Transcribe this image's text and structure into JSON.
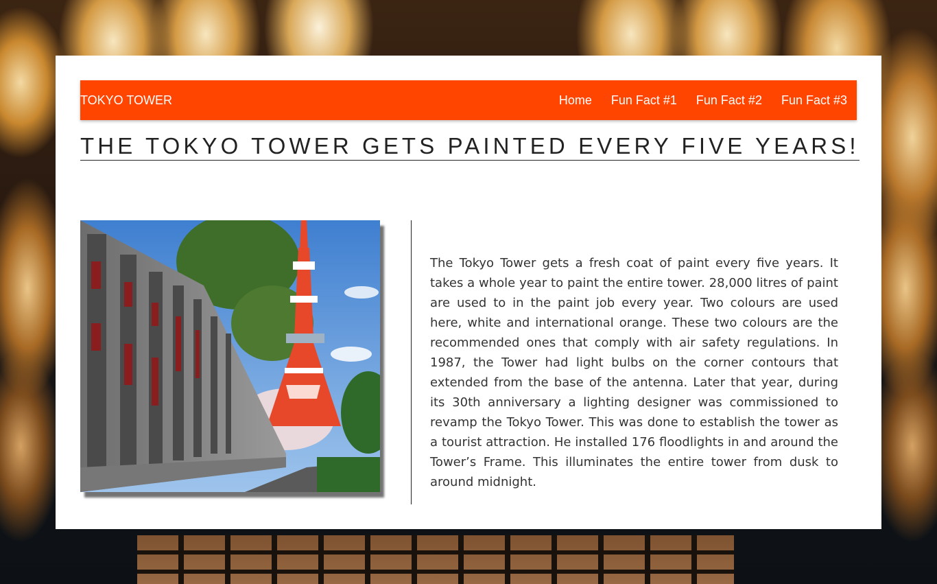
{
  "navbar": {
    "brand": "TOKYO TOWER",
    "links": [
      "Home",
      "Fun Fact #1",
      "Fun Fact #2",
      "Fun Fact #3"
    ]
  },
  "headline": "THE TOKYO TOWER GETS PAINTED EVERY FIVE YEARS!",
  "body": "The Tokyo Tower gets a fresh coat of paint every five years. It takes a whole year to paint the entire tower. 28,000 litres of paint are used to in the paint job every year. Two colours are used here, white and international orange. These two colours are the recommended ones that comply with air safety regulations. In 1987, the Tower had light bulbs on the corner contours that extended from the base of the antenna. Later that year, during its 30th anniversary a lighting designer was commissioned to revamp the Tokyo Tower. This was done to establish the tower as a tourist attraction. He installed 176 floodlights in and around the Tower’s Frame. This illuminates the entire tower from dusk to around midnight.",
  "colors": {
    "navbar": "#ff4500",
    "card": "#ffffff",
    "tower_orange": "#e8482a"
  }
}
